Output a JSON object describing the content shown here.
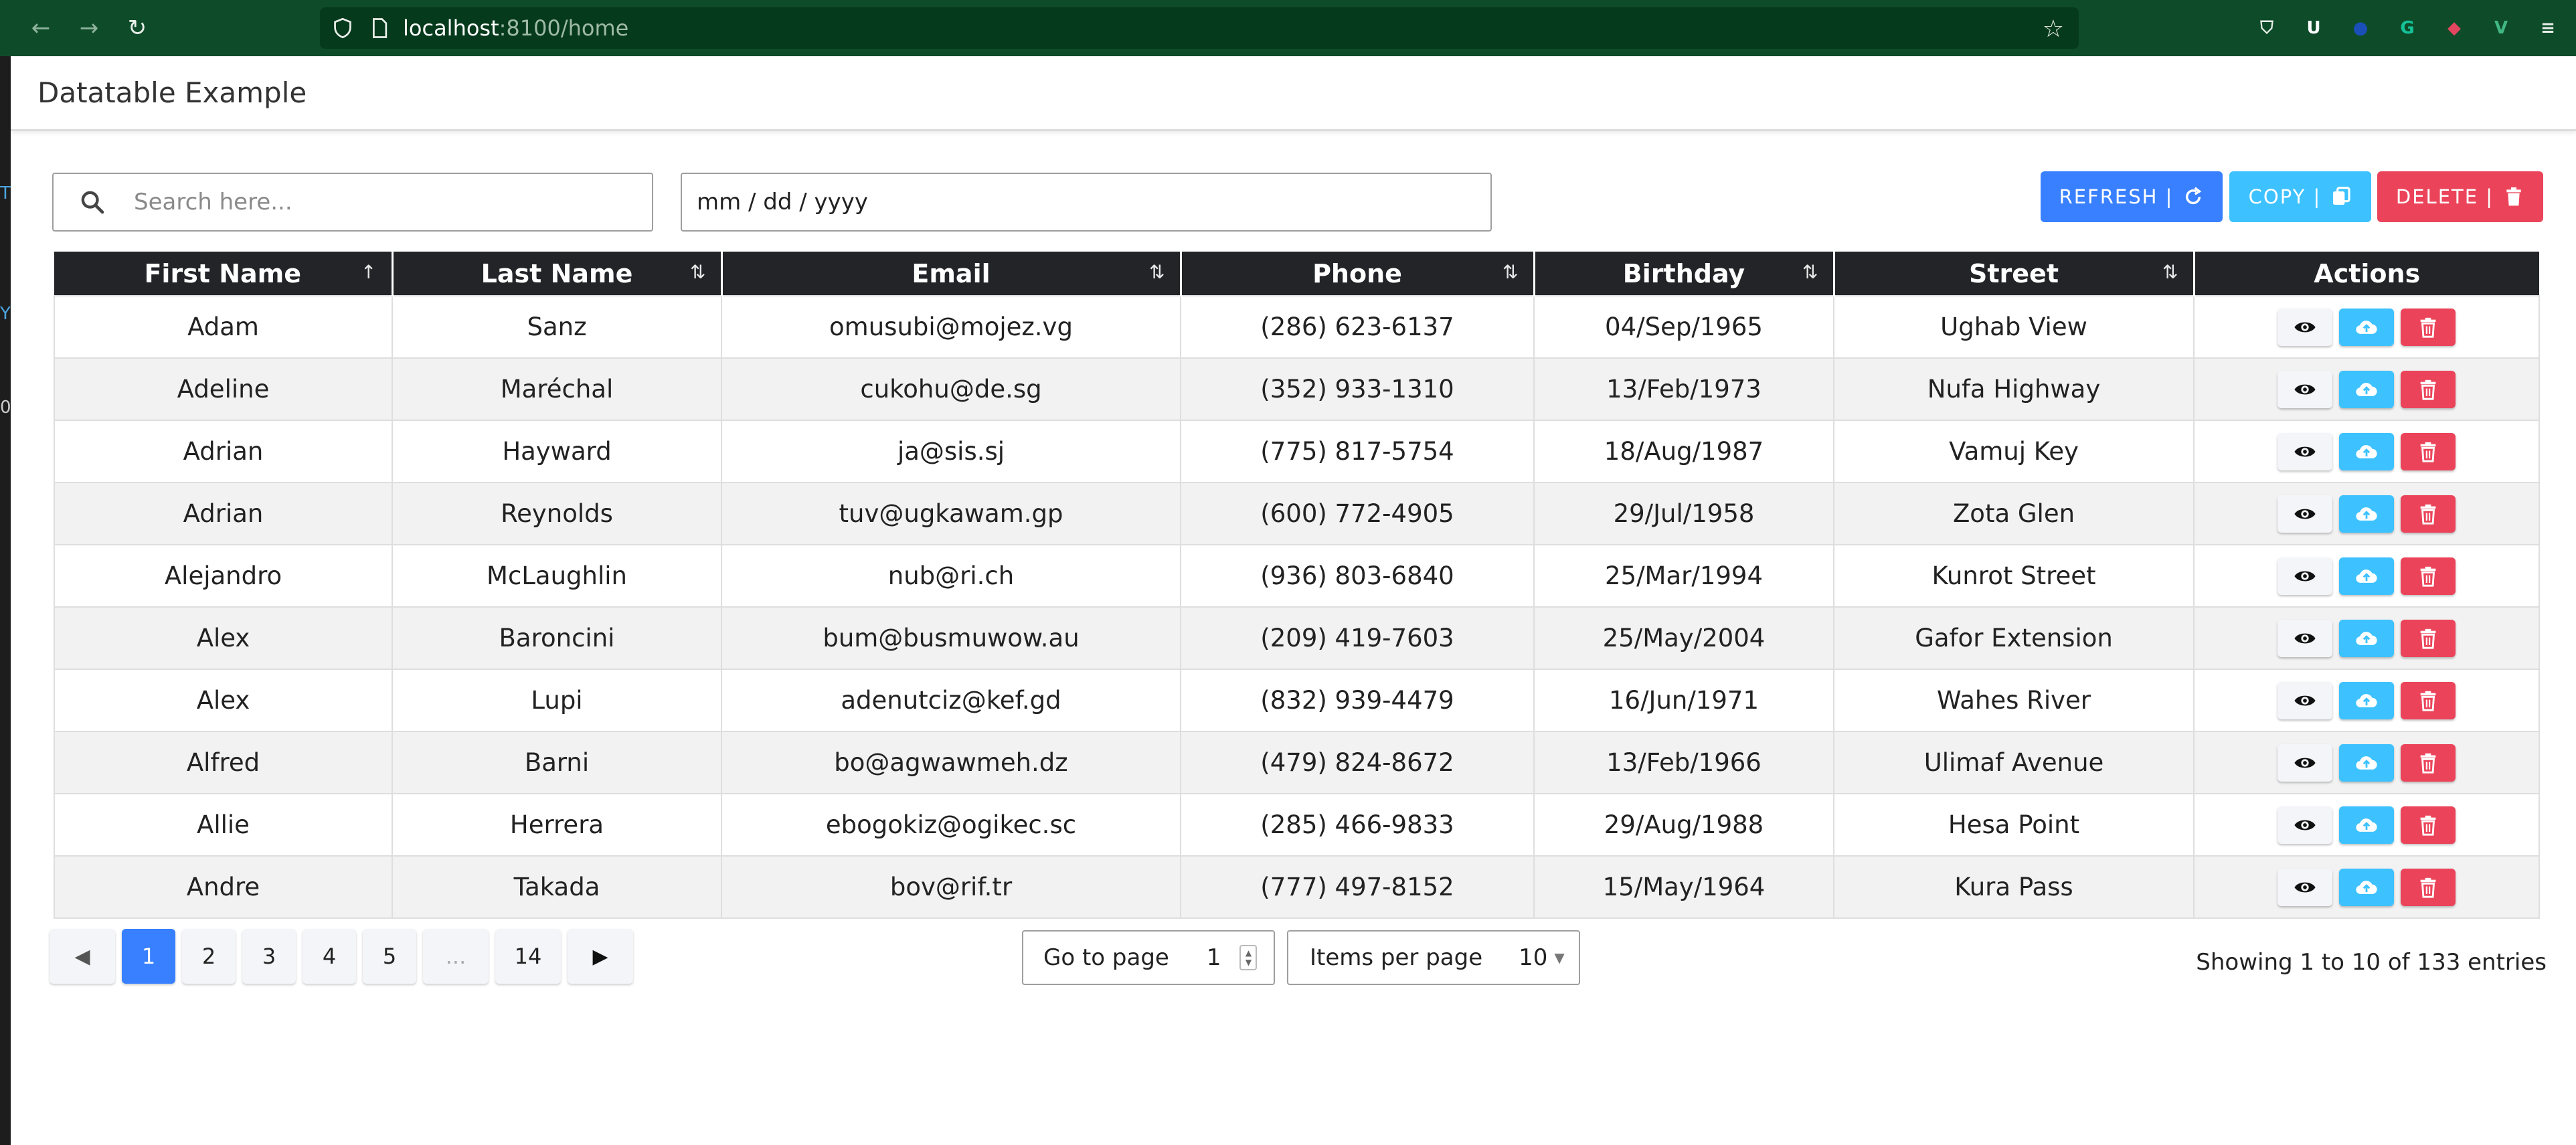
{
  "browser": {
    "url_host": "localhost",
    "url_path": ":8100/home",
    "extensions": [
      {
        "name": "pocket-icon",
        "glyph": "⛉",
        "color": "#e9efe9"
      },
      {
        "name": "user-extension-icon",
        "glyph": "U",
        "color": "#ffffff"
      },
      {
        "name": "circle-extension-icon",
        "glyph": "●",
        "color": "#1a4fb8"
      },
      {
        "name": "grammarly-icon",
        "glyph": "G",
        "color": "#15c39a"
      },
      {
        "name": "shield-extension-icon",
        "glyph": "◆",
        "color": "#e2475f"
      },
      {
        "name": "vue-devtools-icon",
        "glyph": "V",
        "color": "#41b883"
      },
      {
        "name": "menu-icon",
        "glyph": "≡",
        "color": "#e9efe9"
      }
    ]
  },
  "app": {
    "title": "Datatable Example"
  },
  "toolbar": {
    "search_placeholder": "Search here...",
    "date_placeholder": "mm / dd / yyyy",
    "refresh_label": "REFRESH |",
    "copy_label": "COPY |",
    "delete_label": "DELETE |"
  },
  "table": {
    "columns": [
      {
        "label": "First Name",
        "sort": "asc"
      },
      {
        "label": "Last Name",
        "sort": "both"
      },
      {
        "label": "Email",
        "sort": "both"
      },
      {
        "label": "Phone",
        "sort": "both"
      },
      {
        "label": "Birthday",
        "sort": "both"
      },
      {
        "label": "Street",
        "sort": "both"
      },
      {
        "label": "Actions",
        "sort": "none"
      }
    ],
    "rows": [
      [
        "Adam",
        "Sanz",
        "omusubi@mojez.vg",
        "(286) 623-6137",
        "04/Sep/1965",
        "Ughab View"
      ],
      [
        "Adeline",
        "Maréchal",
        "cukohu@de.sg",
        "(352) 933-1310",
        "13/Feb/1973",
        "Nufa Highway"
      ],
      [
        "Adrian",
        "Hayward",
        "ja@sis.sj",
        "(775) 817-5754",
        "18/Aug/1987",
        "Vamuj Key"
      ],
      [
        "Adrian",
        "Reynolds",
        "tuv@ugkawam.gp",
        "(600) 772-4905",
        "29/Jul/1958",
        "Zota Glen"
      ],
      [
        "Alejandro",
        "McLaughlin",
        "nub@ri.ch",
        "(936) 803-6840",
        "25/Mar/1994",
        "Kunrot Street"
      ],
      [
        "Alex",
        "Baroncini",
        "bum@busmuwow.au",
        "(209) 419-7603",
        "25/May/2004",
        "Gafor Extension"
      ],
      [
        "Alex",
        "Lupi",
        "adenutciz@kef.gd",
        "(832) 939-4479",
        "16/Jun/1971",
        "Wahes River"
      ],
      [
        "Alfred",
        "Barni",
        "bo@agwawmeh.dz",
        "(479) 824-8672",
        "13/Feb/1966",
        "Ulimaf Avenue"
      ],
      [
        "Allie",
        "Herrera",
        "ebogokiz@ogikec.sc",
        "(285) 466-9833",
        "29/Aug/1988",
        "Hesa Point"
      ],
      [
        "Andre",
        "Takada",
        "bov@rif.tr",
        "(777) 497-8152",
        "15/May/1964",
        "Kura Pass"
      ]
    ]
  },
  "pagination": {
    "pages": [
      "1",
      "2",
      "3",
      "4",
      "5",
      "...",
      "14"
    ],
    "current": "1",
    "goto_label": "Go to page",
    "goto_value": "1",
    "per_page_label": "Items per page",
    "per_page_value": "10",
    "summary": "Showing 1 to 10 of 133 entries"
  },
  "colors": {
    "primary": "#3880ff",
    "secondary": "#3dc2ff",
    "danger": "#eb445a",
    "header_dark": "#222428",
    "browser_green": "#0e4c29"
  }
}
